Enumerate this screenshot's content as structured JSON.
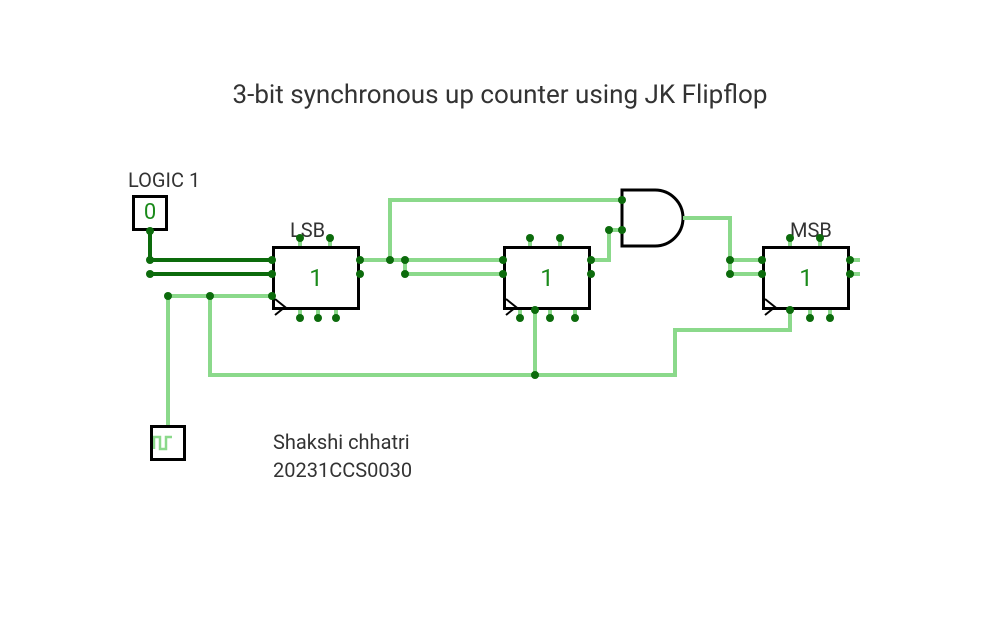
{
  "title": "3-bit synchronous up counter using JK Flipflop",
  "labels": {
    "logic1": "LOGIC 1",
    "lsb": "LSB",
    "msb": "MSB"
  },
  "components": {
    "logic1_value": "0",
    "ff_lsb_value": "1",
    "ff_mid_value": "1",
    "ff_msb_value": "1"
  },
  "author": {
    "name": "Shakshi chhatri",
    "id": "20231CCS0030"
  },
  "colors": {
    "wire_dark": "#0c6b0c",
    "wire_light": "#8bd98b",
    "node": "#0c6b0c",
    "text_green": "#1a8a1a"
  }
}
